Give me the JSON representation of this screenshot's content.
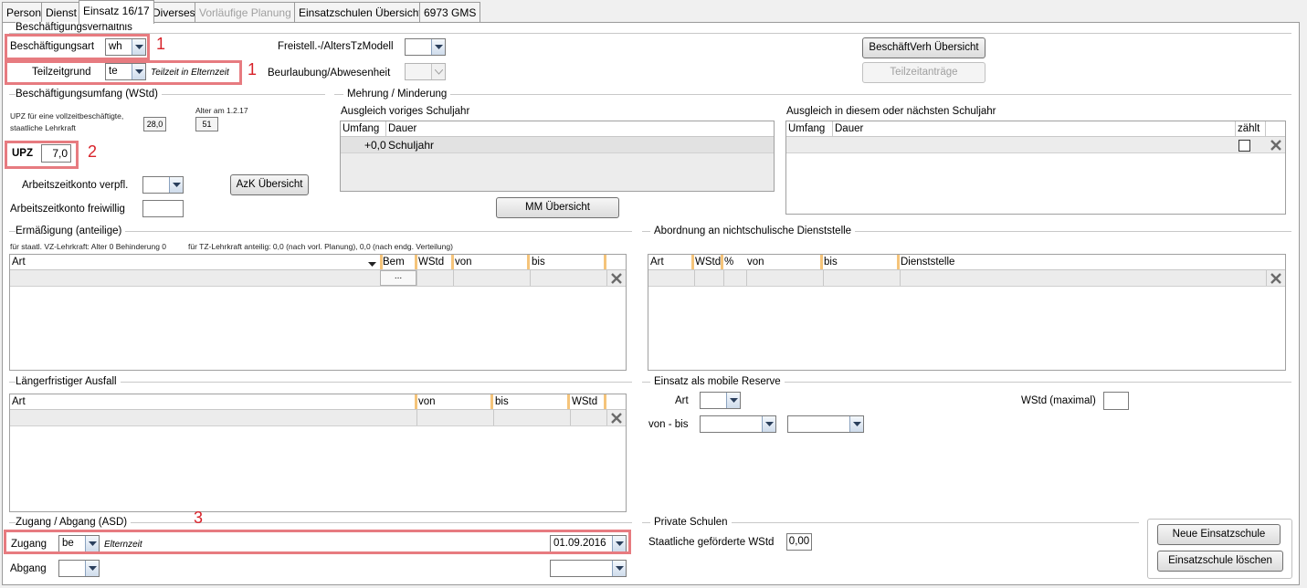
{
  "tabs": {
    "person": "Person",
    "dienst": "Dienst",
    "einsatz": "Einsatz 16/17",
    "diverses": "Diverses",
    "vorlaeufige": "Vorläufige Planung",
    "einsatzschulen": "Einsatzschulen Übersicht",
    "gms": "6973 GMS"
  },
  "beschaeftigung": {
    "section": "Beschäftigungsverhältnis",
    "art_label": "Beschäftigungsart",
    "art_value": "wh",
    "teilzeit_label": "Teilzeitgrund",
    "teilzeit_value": "te",
    "teilzeit_note": "Teilzeit in Elternzeit",
    "freistell_label": "Freistell.-/AltersTzModell",
    "beurlaubung_label": "Beurlaubung/Abwesenheit",
    "btn_uebersicht": "BeschäftVerh Übersicht",
    "btn_teilzeit": "Teilzeitanträge"
  },
  "umfang": {
    "section": "Beschäftigungsumfang (WStd)",
    "upz_desc1": "UPZ für eine vollzeitbeschäftigte,",
    "upz_desc2": "staatliche Lehrkraft",
    "upz_vz_value": "28,0",
    "alter_label": "Alter am 1.2.17",
    "alter_value": "51",
    "upz_label": "UPZ",
    "upz_value": "7,0",
    "azk_verpfl": "Arbeitszeitkonto verpfl.",
    "azk_freiwillig": "Arbeitszeitkonto freiwillig",
    "btn_azk": "AzK Übersicht"
  },
  "mehrung": {
    "section": "Mehrung / Minderung",
    "voriges_title": "Ausgleich voriges Schuljahr",
    "naechstes_title": "Ausgleich in diesem oder nächsten Schuljahr",
    "col_umfang": "Umfang",
    "col_dauer": "Dauer",
    "col_zaehlt": "zählt",
    "row_umfang": "+0,0",
    "row_dauer": "Schuljahr",
    "btn_mm": "MM Übersicht"
  },
  "ermaessigung": {
    "section": "Ermäßigung (anteilige)",
    "note1": "für staatl. VZ-Lehrkraft: Alter 0 Behinderung 0",
    "note2": "für TZ-Lehrkraft anteilig: 0,0 (nach vorl. Planung), 0,0 (nach endg. Verteilung)",
    "cols": [
      "Art",
      "Bem",
      "WStd",
      "von",
      "bis"
    ],
    "row_bem": "..."
  },
  "abordnung": {
    "section": "Abordnung an nichtschulische Dienststelle",
    "cols": [
      "Art",
      "WStd",
      "%",
      "von",
      "bis",
      "Dienststelle"
    ]
  },
  "ausfall": {
    "section": "Längerfristiger Ausfall",
    "cols": [
      "Art",
      "von",
      "bis",
      "WStd"
    ]
  },
  "reserve": {
    "section": "Einsatz als mobile Reserve",
    "art_label": "Art",
    "wstd_label": "WStd (maximal)",
    "von_bis_label": "von - bis"
  },
  "zugang": {
    "section": "Zugang / Abgang (ASD)",
    "zugang_label": "Zugang",
    "zugang_value": "be",
    "zugang_note": "Elternzeit",
    "zugang_date": "01.09.2016",
    "abgang_label": "Abgang"
  },
  "private": {
    "section": "Private Schulen",
    "label": "Staatliche geförderte WStd",
    "value": "0,00"
  },
  "buttons": {
    "neue": "Neue Einsatzschule",
    "loeschen": "Einsatzschule löschen"
  },
  "annotations": [
    "1",
    "1",
    "2",
    "3"
  ],
  "colors": {
    "highlight": "#e77b80",
    "annotation_number": "#d8232a"
  }
}
